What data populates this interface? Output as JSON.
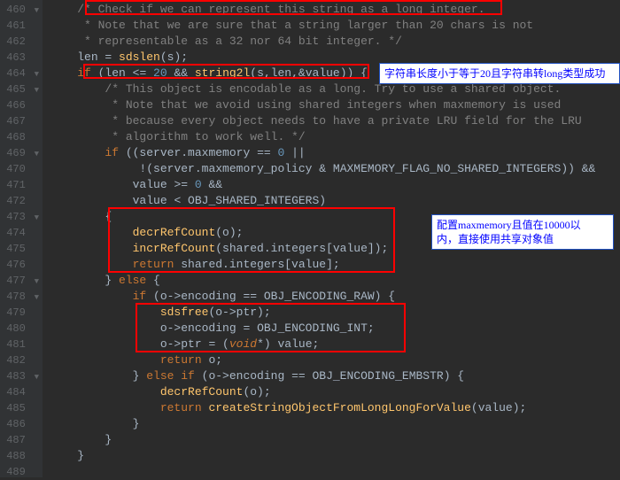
{
  "gutter": {
    "lines": [
      {
        "num": "460",
        "fold": "▼"
      },
      {
        "num": "461",
        "fold": ""
      },
      {
        "num": "462",
        "fold": ""
      },
      {
        "num": "463",
        "fold": ""
      },
      {
        "num": "464",
        "fold": "▼"
      },
      {
        "num": "465",
        "fold": "▼"
      },
      {
        "num": "466",
        "fold": ""
      },
      {
        "num": "467",
        "fold": ""
      },
      {
        "num": "468",
        "fold": ""
      },
      {
        "num": "469",
        "fold": "▼"
      },
      {
        "num": "470",
        "fold": ""
      },
      {
        "num": "471",
        "fold": ""
      },
      {
        "num": "472",
        "fold": ""
      },
      {
        "num": "473",
        "fold": "▼"
      },
      {
        "num": "474",
        "fold": ""
      },
      {
        "num": "475",
        "fold": ""
      },
      {
        "num": "476",
        "fold": ""
      },
      {
        "num": "477",
        "fold": "▼"
      },
      {
        "num": "478",
        "fold": "▼"
      },
      {
        "num": "479",
        "fold": ""
      },
      {
        "num": "480",
        "fold": ""
      },
      {
        "num": "481",
        "fold": ""
      },
      {
        "num": "482",
        "fold": ""
      },
      {
        "num": "483",
        "fold": "▼"
      },
      {
        "num": "484",
        "fold": ""
      },
      {
        "num": "485",
        "fold": ""
      },
      {
        "num": "486",
        "fold": ""
      },
      {
        "num": "487",
        "fold": ""
      },
      {
        "num": "488",
        "fold": ""
      },
      {
        "num": "489",
        "fold": ""
      }
    ]
  },
  "code": {
    "l460_c1": "/* Check if we can represent this string as a long integer.",
    "l461_c1": " * Note that we are sure that a string larger than 20 chars is not",
    "l462_c1": " * representable as a 32 nor 64 bit integer. */",
    "l463_id1": "len",
    "l463_op1": " = ",
    "l463_fn1": "sdslen",
    "l463_id2": "(s);",
    "l464_kw1": "if",
    "l464_id1": " (len ",
    "l464_op1": "<=",
    "l464_num1": " 20 ",
    "l464_op2": "&&",
    "l464_fn1": " string2l",
    "l464_id2": "(s,len,",
    "l464_op3": "&",
    "l464_id3": "value)) {",
    "l465_c1": "/* This object is encodable as a long. Try to use a shared object.",
    "l466_c1": " * Note that we avoid using shared integers when maxmemory is used",
    "l467_c1": " * because every object needs to have a private LRU field for the LRU",
    "l468_c1": " * algorithm to work well. */",
    "l469_kw1": "if",
    "l469_id1": " ((server.maxmemory",
    "l469_op1": " == ",
    "l469_num1": "0",
    "l469_op2": " ||",
    "l470_op1": "!",
    "l470_id1": "(server.maxmemory_policy ",
    "l470_op2": "&",
    "l470_id2": " MAXMEMORY_FLAG_NO_SHARED_INTEGERS)) ",
    "l470_op3": "&&",
    "l471_id1": "value ",
    "l471_op1": ">=",
    "l471_num1": " 0 ",
    "l471_op2": "&&",
    "l472_id1": "value ",
    "l472_op1": "<",
    "l472_id2": " OBJ_SHARED_INTEGERS)",
    "l473_id1": "{",
    "l474_fn1": "decrRefCount",
    "l474_id1": "(o);",
    "l475_fn1": "incrRefCount",
    "l475_id1": "(shared.integers[value]);",
    "l476_kw1": "return",
    "l476_id1": " shared.integers[value];",
    "l477_id1": "} ",
    "l477_kw1": "else",
    "l477_id2": " {",
    "l478_kw1": "if",
    "l478_id1": " (o->encoding ",
    "l478_op1": "==",
    "l478_id2": " OBJ_ENCODING_RAW) {",
    "l479_fn1": "sdsfree",
    "l479_id1": "(o->ptr);",
    "l480_id1": "o->encoding ",
    "l480_op1": "=",
    "l480_id2": " OBJ_ENCODING_INT;",
    "l481_id1": "o->ptr ",
    "l481_op1": "=",
    "l481_id2": " (",
    "l481_ty1": "void",
    "l481_op2": "*",
    "l481_id3": ") value;",
    "l482_kw1": "return",
    "l482_id1": " o;",
    "l483_id1": "} ",
    "l483_kw1": "else if",
    "l483_id2": " (o->encoding ",
    "l483_op1": "==",
    "l483_id3": " OBJ_ENCODING_EMBSTR) {",
    "l484_fn1": "decrRefCount",
    "l484_id1": "(o);",
    "l485_kw1": "return",
    "l485_fn1": " createStringObjectFromLongLongForValue",
    "l485_id1": "(value);",
    "l486_id1": "}",
    "l487_id1": "}",
    "l488_id1": "}"
  },
  "annotations": {
    "a1": "字符串长度小于等于20且字符串转long类型成功",
    "a2_line1": "配置maxmemory且值在10000以",
    "a2_line2": "内，直接使用共享对象值"
  }
}
